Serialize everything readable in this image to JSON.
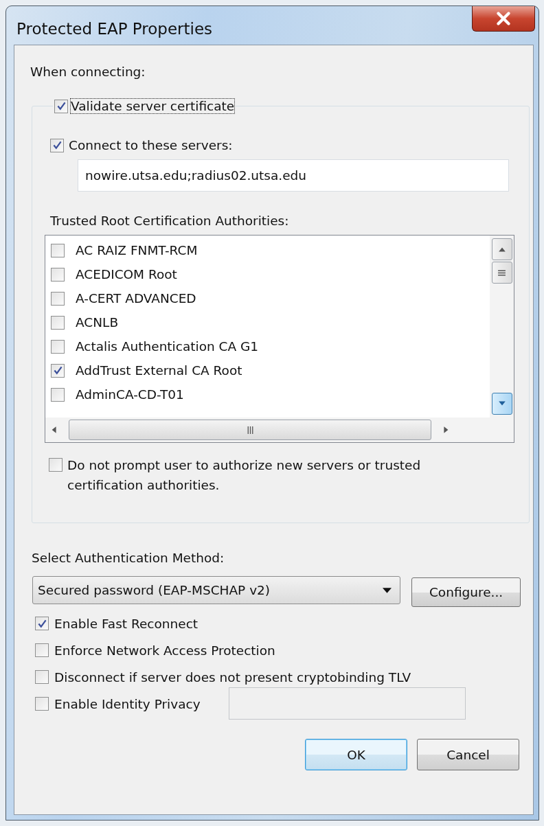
{
  "window": {
    "title": "Protected EAP Properties"
  },
  "when_connecting_label": "When connecting:",
  "validate_server_certificate": {
    "label": "Validate server certificate",
    "checked": true,
    "focused": true
  },
  "connect_to_servers": {
    "label": "Connect to these servers:",
    "checked": true
  },
  "servers_field": {
    "value": "nowire.utsa.edu;radius02.utsa.edu"
  },
  "trusted_root_label": {
    "text": "Trusted Root Certification Authorities:"
  },
  "certificate_authorities": [
    {
      "name": "AC RAIZ FNMT-RCM",
      "checked": false
    },
    {
      "name": "ACEDICOM Root",
      "checked": false
    },
    {
      "name": "A-CERT ADVANCED",
      "checked": false
    },
    {
      "name": "ACNLB",
      "checked": false
    },
    {
      "name": "Actalis Authentication CA G1",
      "checked": false
    },
    {
      "name": "AddTrust External CA Root",
      "checked": true
    },
    {
      "name": "AdminCA-CD-T01",
      "checked": false
    }
  ],
  "do_not_prompt": {
    "label": "Do not prompt user to authorize new servers or trusted certification authorities.",
    "checked": false
  },
  "auth_method_label": {
    "text": "Select Authentication Method:"
  },
  "auth_method_dropdown": {
    "value": "Secured password (EAP-MSCHAP v2)"
  },
  "configure_button": {
    "label": "Configure..."
  },
  "options": [
    {
      "label": "Enable Fast Reconnect",
      "checked": true
    },
    {
      "label": "Enforce Network Access Protection",
      "checked": false
    },
    {
      "label": "Disconnect if server does not present cryptobinding TLV",
      "checked": false
    },
    {
      "label": "Enable Identity Privacy",
      "checked": false
    }
  ],
  "identity_field": {
    "disabled": true
  },
  "buttons": [
    {
      "label": "OK",
      "default": true
    },
    {
      "label": "Cancel",
      "default": false
    }
  ]
}
